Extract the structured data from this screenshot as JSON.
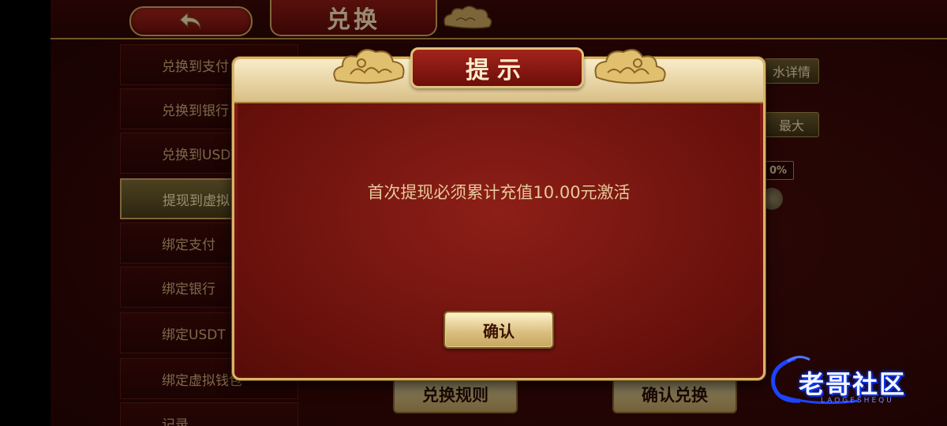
{
  "header": {
    "title": "兑换"
  },
  "sidebar": {
    "items": [
      {
        "label": "兑换到支付"
      },
      {
        "label": "兑换到银行"
      },
      {
        "label": "兑换到USDT"
      },
      {
        "label": "提现到虚拟"
      },
      {
        "label": "绑定支付"
      },
      {
        "label": "绑定银行"
      },
      {
        "label": "绑定USDT"
      },
      {
        "label": "绑定虚拟钱包"
      },
      {
        "label": "记录"
      }
    ]
  },
  "main": {
    "detail_button": "水详情",
    "max_button": "最大",
    "percent_tag": "0%",
    "rules_button": "兑换规则",
    "confirm_exchange_button": "确认兑换"
  },
  "dialog": {
    "title": "提示",
    "message": "首次提现必须累计充值10.00元激活",
    "confirm_label": "确认"
  },
  "watermark": {
    "text": "老哥社区",
    "sub": "LAOGESHEQU"
  }
}
